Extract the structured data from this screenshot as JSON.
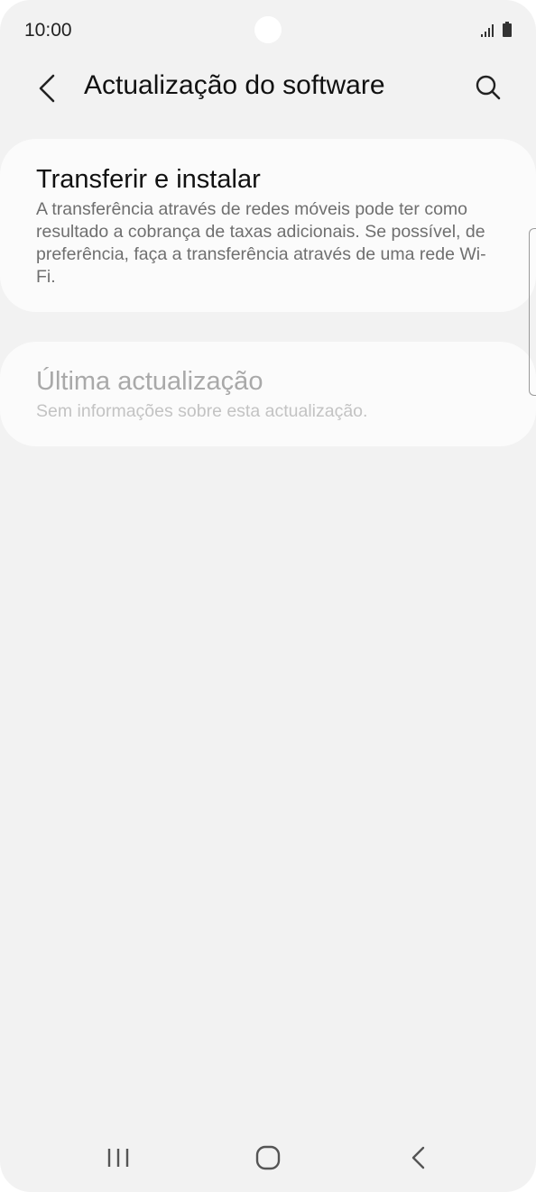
{
  "status_bar": {
    "time": "10:00"
  },
  "header": {
    "title": "Actualização do software",
    "back_icon": "chevron-left-icon",
    "search_icon": "search-icon"
  },
  "cards": {
    "download": {
      "title": "Transferir e instalar",
      "description": "A transferência através de redes móveis pode ter como resultado a cobrança de taxas adicionais. Se possível, de preferência, faça a transferência através de uma rede Wi-Fi."
    },
    "last_update": {
      "title": "Última actualização",
      "description": "Sem informações sobre esta actualização."
    }
  },
  "nav_bar": {
    "recents_icon": "recent-apps-icon",
    "home_icon": "home-icon",
    "back_icon": "back-icon"
  },
  "colors": {
    "background": "#f2f2f2",
    "card": "#fbfbfb",
    "text_primary": "#111111",
    "text_secondary": "#6f6f6f",
    "text_disabled": "#a9a9a9"
  }
}
